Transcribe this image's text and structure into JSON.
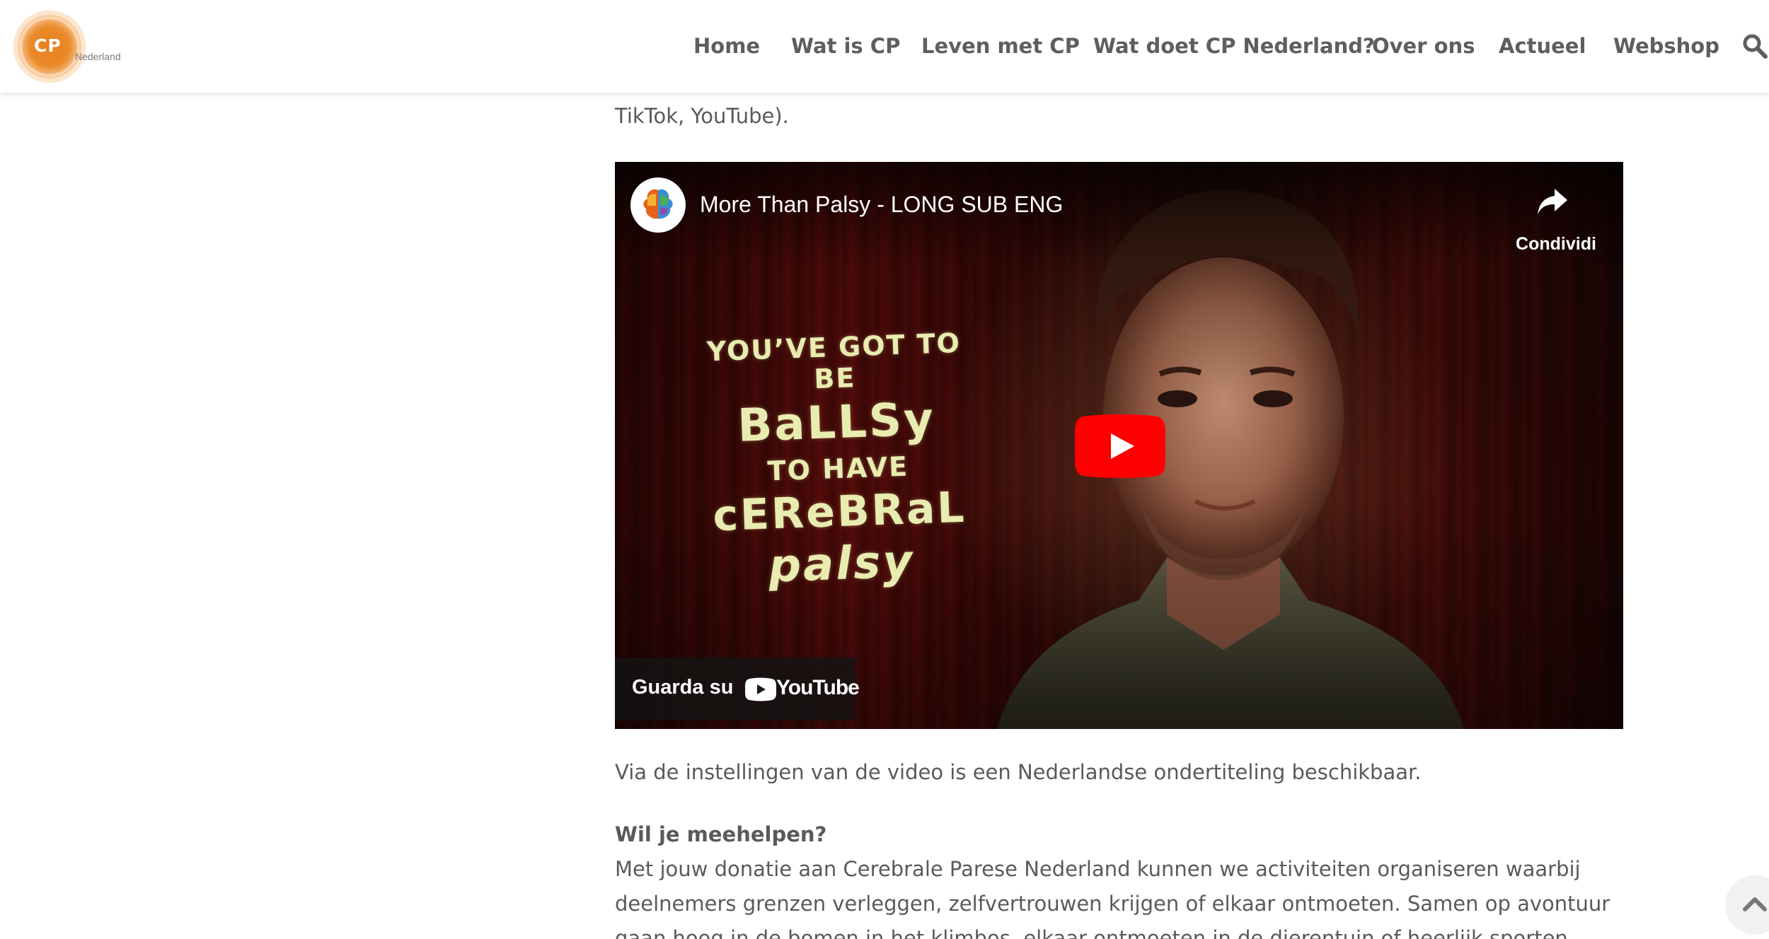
{
  "header": {
    "logo": {
      "mark": "CP",
      "subtitle": "Nederland"
    },
    "nav": [
      {
        "label": "Home"
      },
      {
        "label": "Wat is CP"
      },
      {
        "label": "Leven met CP"
      },
      {
        "label": "Wat doet CP Nederland?"
      },
      {
        "label": "Over ons"
      },
      {
        "label": "Actueel"
      },
      {
        "label": "Webshop"
      }
    ],
    "search_icon": "search-icon"
  },
  "article": {
    "partial_line": "TikTok, YouTube).",
    "video": {
      "title": "More Than Palsy - LONG SUB ENG",
      "share_label": "Condividi",
      "watch_on_label": "Guarda su",
      "youtube_wordmark": "YouTube",
      "poster_text": {
        "line1": "YOU’VE GOT TO BE",
        "line2": "BaLLSy",
        "line3": "TO HAVE",
        "line4": "cEReBRaL",
        "line5": "palsy"
      },
      "colors": {
        "play": "#ff0000",
        "title": "#ffffff"
      }
    },
    "caption": "Via de instellingen van de video is een Nederlandse ondertiteling beschikbaar.",
    "help_heading": "Wil je meehelpen?",
    "help_paragraph": "Met jouw donatie aan Cerebrale Parese Nederland kunnen we activiteiten organiseren waarbij deelnemers grenzen verleggen, zelfvertrouwen krijgen of elkaar ontmoeten. Samen op avontuur gaan hoog in de bomen in het klimbos, elkaar ontmoeten in de dierentuin of heerlijk sporten."
  },
  "scroll_top_icon": "chevron-up-icon",
  "colors": {
    "brand": "#e8801e",
    "text": "#5a5a5a",
    "nav": "#5e5e5e"
  }
}
